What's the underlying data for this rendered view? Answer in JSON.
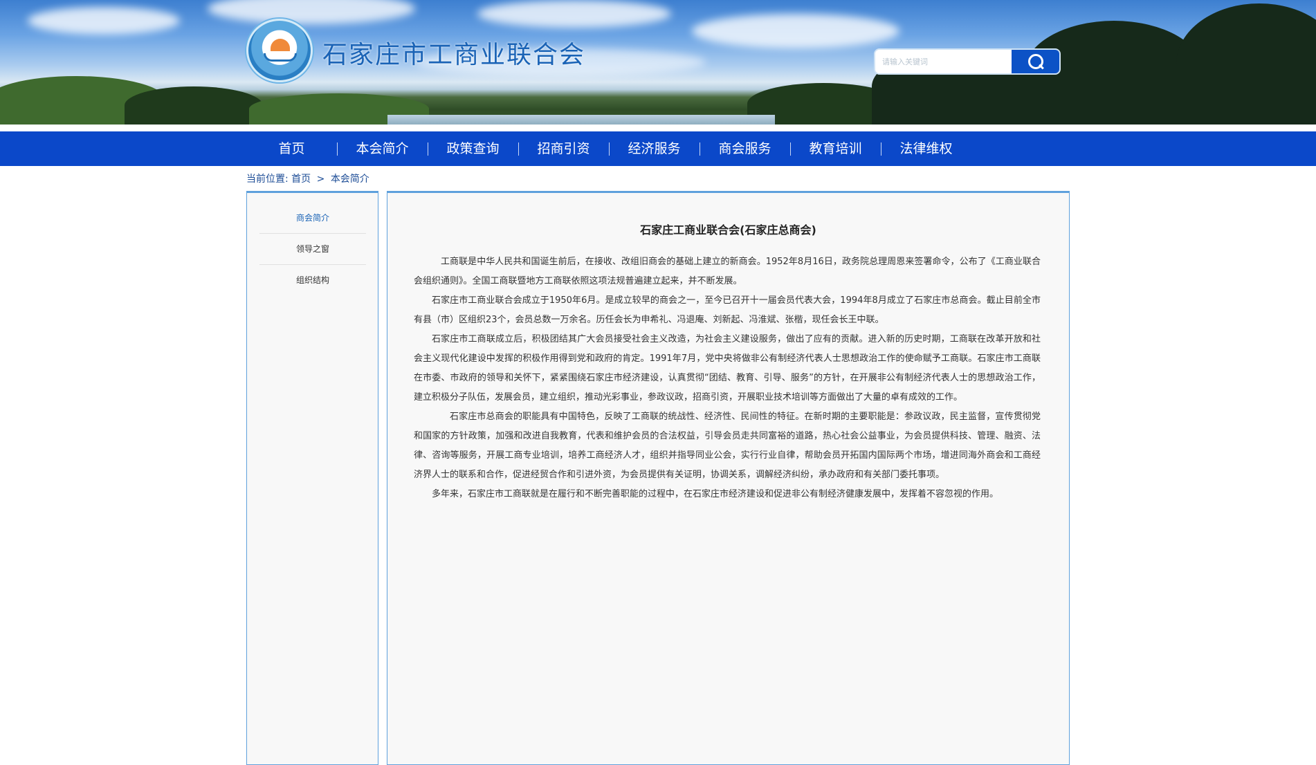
{
  "header": {
    "site_title": "石家庄市工商业联合会",
    "search_placeholder": "请输入关键词"
  },
  "nav": {
    "items": [
      "首页",
      "本会简介",
      "政策查询",
      "招商引资",
      "经济服务",
      "商会服务",
      "教育培训",
      "法律维权"
    ]
  },
  "breadcrumb": {
    "label": "当前位置:",
    "home": "首页",
    "separator": ">",
    "current": "本会简介"
  },
  "sidebar": {
    "items": [
      {
        "label": "商会简介",
        "active": true
      },
      {
        "label": "领导之窗",
        "active": false
      },
      {
        "label": "组织结构",
        "active": false
      }
    ]
  },
  "article": {
    "title": "石家庄工商业联合会(石家庄总商会)",
    "paragraphs": [
      "工商联是中华人民共和国诞生前后，在接收、改组旧商会的基础上建立的新商会。1952年8月16日，政务院总理周恩来签署命令，公布了《工商业联合会组织通则》。全国工商联暨地方工商联依照这项法规普遍建立起来，并不断发展。",
      "石家庄市工商业联合会成立于1950年6月。是成立较早的商会之一，至今已召开十一届会员代表大会，1994年8月成立了石家庄市总商会。截止目前全市有县（市）区组织23个，会员总数一万余名。历任会长为申希礼、冯退庵、刘新起、冯淮斌、张楷，现任会长王中联。",
      "石家庄市工商联成立后，积极团结其广大会员接受社会主义改造，为社会主义建设服务，做出了应有的贡献。进入新的历史时期，工商联在改革开放和社会主义现代化建设中发挥的积极作用得到党和政府的肯定。1991年7月，党中央将做非公有制经济代表人士思想政治工作的使命赋予工商联。石家庄市工商联在市委、市政府的领导和关怀下，紧紧围绕石家庄市经济建设，认真贯彻“团结、教育、引导、服务”的方针，在开展非公有制经济代表人士的思想政治工作，建立积极分子队伍，发展会员，建立组织，推动光彩事业，参政议政，招商引资，开展职业技术培训等方面做出了大量的卓有成效的工作。",
      "石家庄市总商会的职能具有中国特色，反映了工商联的统战性、经济性、民间性的特征。在新时期的主要职能是：参政议政，民主监督，宣传贯彻党和国家的方针政策，加强和改进自我教育，代表和维护会员的合法权益，引导会员走共同富裕的道路，热心社会公益事业，为会员提供科技、管理、融资、法律、咨询等服务，开展工商专业培训，培养工商经济人才，组织并指导同业公会，实行行业自律，帮助会员开拓国内国际两个市场，增进同海外商会和工商经济界人士的联系和合作，促进经贸合作和引进外资，为会员提供有关证明，协调关系，调解经济纠纷，承办政府和有关部门委托事项。",
      "多年来，石家庄市工商联就是在履行和不断完善职能的过程中，在石家庄市经济建设和促进非公有制经济健康发展中，发挥着不容忽视的作用。"
    ]
  },
  "colors": {
    "nav_bg": "#0b48c9",
    "accent": "#1a63b6",
    "panel_border": "#5ea0dc"
  }
}
